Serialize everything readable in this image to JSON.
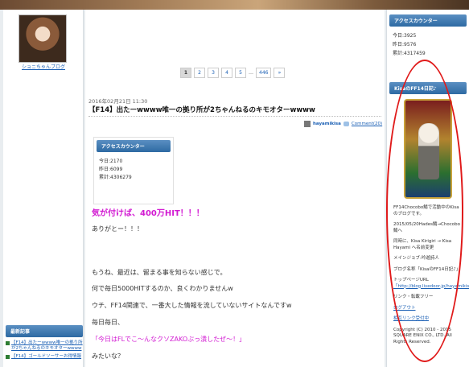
{
  "sidebar_left": {
    "profile_link": "ショニちゃんブログ",
    "recent": {
      "header": "最新記事",
      "items": [
        "【F14】出たーwwww唯一の拠り所が2ちゃんねるのキモオターwwww",
        "【F14】ゴールドソーサーお得情報"
      ]
    }
  },
  "pagination": {
    "pages": [
      "1",
      "2",
      "3",
      "4",
      "5"
    ],
    "current": "1",
    "ellipsis": "…",
    "last": "446",
    "next": "»"
  },
  "post": {
    "date": "2016年02月21日 11:30",
    "title": "【F14】出たーwwww唯一の拠り所が2ちゃんねるのキモオターwwww",
    "author": "hayamikisa",
    "comments": "Comment(20)",
    "counter": {
      "header": "アクセスカウンター",
      "today": "今日:2170",
      "yesterday": "昨日:6099",
      "total": "累計:4306279"
    },
    "headline": "気が付けば、400万HIT！！！",
    "paragraphs": [
      "ありがとー！！！",
      "もうね、最近は、留まる事を知らない感じで。",
      "何で毎日5000HITするのか、良くわかりませんw",
      "ウチ、FF14関連で、一番大した情報を流していないサイトなんですw",
      "毎日毎日、",
      "「今日はFLでこ～んなクソZAKOぶっ潰したぜ～！」",
      "みたいな？"
    ]
  },
  "sidebar_right": {
    "counter": {
      "header": "アクセスカウンター",
      "today": "今日:3925",
      "yesterday": "昨日:9576",
      "total": "累計:4317459"
    },
    "profile": {
      "header": "KisaのFF14日記♪",
      "lines": [
        "FF14Chocobo鯖で活動中のKisaのブログです。",
        "2015/05/20Hades鯖→Chocobo鯖へ",
        "同時に、Kisa Kirigiri → Kisa Hayami へ名前変更",
        "メインジョブ:吟遊詩人",
        "ブログ名称「KisaのFF14日記♪」",
        "トップページURL"
      ],
      "url": "「http://blog.livedoor.jp/hayamikisa/」",
      "link_free": "リンク・転載フリー",
      "logout": "ログアウト",
      "mutual_links": "相互リンク受付中",
      "copyright": "Copyright (C) 2010 - 2015 SQUARE ENIX CO., LTD. All Rights Reserved."
    }
  },
  "colors": {
    "accent_blue": "#2e6aa3",
    "pink_text": "#d21ad2",
    "annotation_red": "#e01a1a"
  }
}
